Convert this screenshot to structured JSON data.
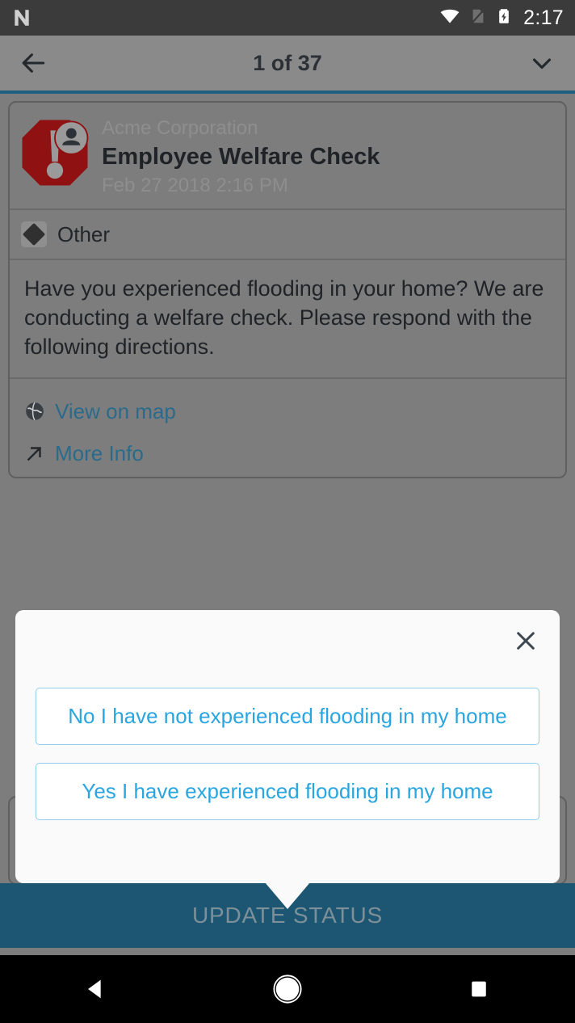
{
  "status_bar": {
    "app_icon": "android-n-logo-icon",
    "wifi_icon": "wifi-icon",
    "sim_icon": "no-sim-card-icon",
    "battery_icon": "battery-charging-icon",
    "time": "2:17"
  },
  "toolbar": {
    "back_icon": "arrow-left-icon",
    "title": "1 of 37",
    "expand_icon": "chevron-down-icon",
    "accent_color": "#1f5f80"
  },
  "alert_card": {
    "severity_icon": "octagon-alert-person-icon",
    "severity_color": "#8f1111",
    "organization": "Acme Corporation",
    "title": "Employee Welfare Check",
    "timestamp": "Feb 27 2018 2:16 PM",
    "category": {
      "icon": "diamond-icon",
      "label": "Other"
    },
    "message": "Have you experienced flooding in your home? We are conducting a welfare check. Please respond with the following directions.",
    "links": [
      {
        "icon": "globe-icon",
        "label": "View on map"
      },
      {
        "icon": "arrow-up-right-icon",
        "label": "More Info"
      }
    ],
    "link_color": "#2a6b8c"
  },
  "update_status_bar": {
    "label": "UPDATE STATUS",
    "background_color": "#1d5672"
  },
  "response_dialog": {
    "close_icon": "close-icon",
    "options": [
      "No I have not experienced flooding in my home",
      "Yes I have experienced flooding in my home"
    ],
    "option_text_color": "#29a6e0",
    "option_border_color": "#8fcdea"
  },
  "nav_bar": {
    "back_icon": "nav-back-triangle-icon",
    "home_icon": "nav-home-circle-icon",
    "recents_icon": "nav-recents-square-icon"
  }
}
